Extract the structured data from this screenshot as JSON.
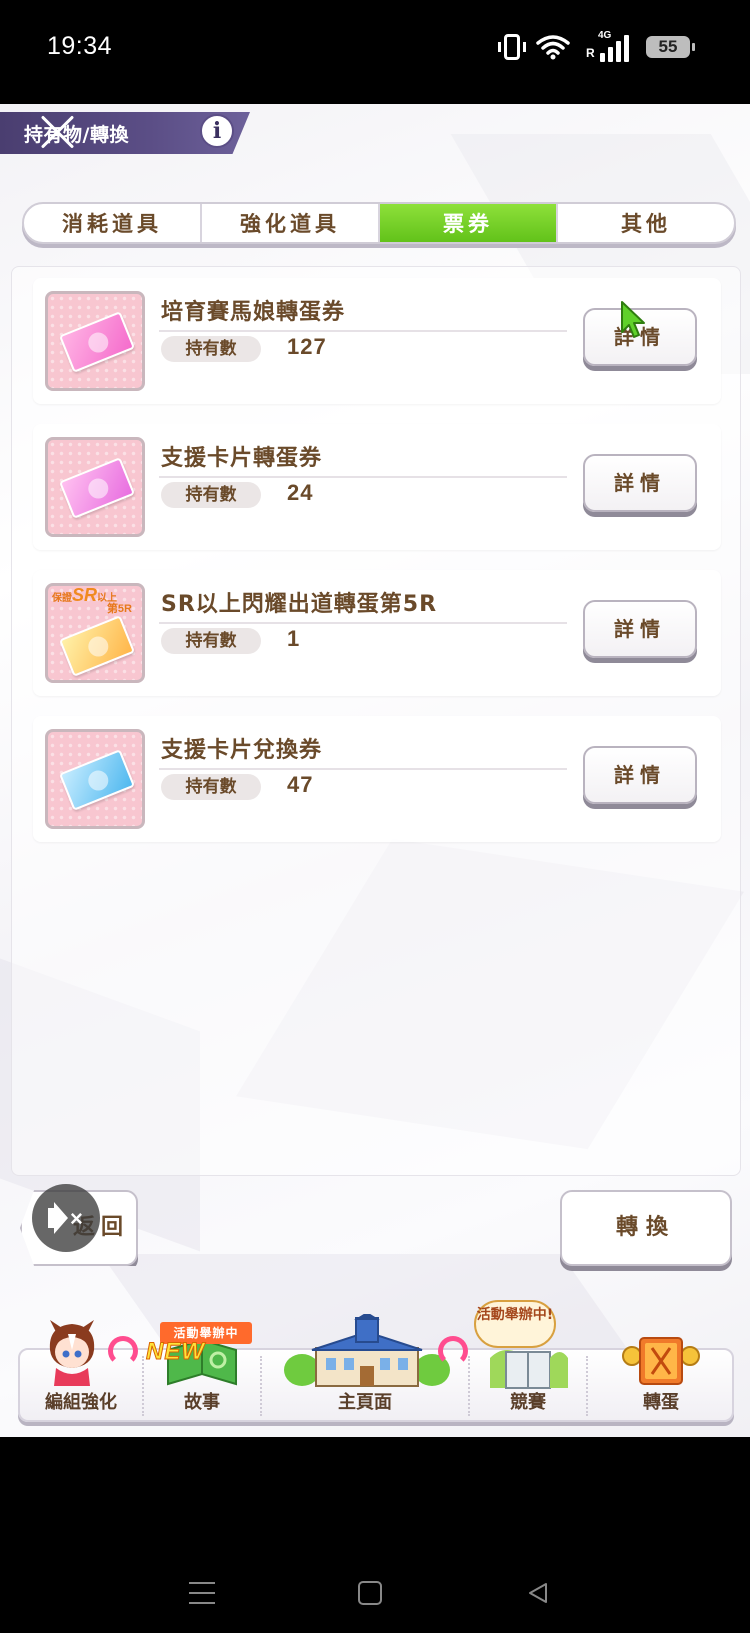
{
  "status_bar": {
    "time": "19:34",
    "network": "4G",
    "roaming": "R",
    "battery": "55"
  },
  "header": {
    "title": "持有物/轉換",
    "info_label": "i"
  },
  "tabs": [
    {
      "label": "消耗道具",
      "active": false
    },
    {
      "label": "強化道具",
      "active": false
    },
    {
      "label": "票券",
      "active": true
    },
    {
      "label": "其他",
      "active": false
    }
  ],
  "items": [
    {
      "name": "培育賽馬娘轉蛋券",
      "count_label": "持有數",
      "count": "127",
      "detail_label": "詳情",
      "icon": "pink-ticket-icon"
    },
    {
      "name": "支援卡片轉蛋券",
      "count_label": "持有數",
      "count": "24",
      "detail_label": "詳情",
      "icon": "magenta-ticket-icon"
    },
    {
      "name": "SR以上閃耀出道轉蛋第5R",
      "count_label": "持有數",
      "count": "1",
      "detail_label": "詳情",
      "icon": "sr-ticket-icon",
      "icon_text": {
        "line1": "保證",
        "sr": "SR",
        "line2": "以上",
        "round": "第5R"
      }
    },
    {
      "name": "支援卡片兌換券",
      "count_label": "持有數",
      "count": "47",
      "detail_label": "詳情",
      "icon": "blue-ticket-icon"
    }
  ],
  "buttons": {
    "back": "返回",
    "convert": "轉換"
  },
  "bottom_nav": {
    "items": [
      {
        "label": "編組強化"
      },
      {
        "label": "故事"
      },
      {
        "label": "主頁面"
      },
      {
        "label": "競賽"
      },
      {
        "label": "轉蛋"
      }
    ],
    "story_event_tag": "活動舉辦中",
    "story_new_tag": "NEW",
    "race_event_bubble": "活動舉辦中!"
  },
  "colors": {
    "accent_tab": "#62c21a",
    "text_brown": "#6a4a2a",
    "header_bg": "#5b4e86"
  }
}
